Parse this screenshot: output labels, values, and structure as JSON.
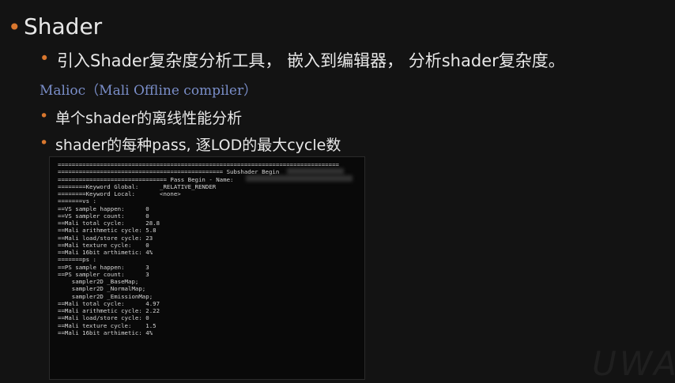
{
  "bullets": {
    "level0_glyph": "•",
    "level1_glyph": "•"
  },
  "slide": {
    "title": "Shader",
    "point1": "引入Shader复杂度分析工具， 嵌入到编辑器， 分析shader复杂度。",
    "tool_name": "Malioc（Mali Offline compiler）",
    "point2": "单个shader的离线性能分析",
    "point3": "shader的每种pass, 逐LOD的最大cycle数"
  },
  "code_lines": [
    "================================================================================",
    "=============================================== Subshader Begin",
    "=============================== Pass Begin - Name:",
    "========Keyword Global:      _RELATIVE_RENDER",
    "========Keyword Local:       <none>",
    "=======vs :",
    "==VS sample happen:      0",
    "==VS sampler count:      0",
    "==Mali total cycle:      28.8",
    "==Mali arithmetic cycle: 5.8",
    "==Mali load/store cycle: 23",
    "==Mali texture cycle:    0",
    "==Mali 16bit arthimetic: 4%",
    "=======ps :",
    "==PS sample happen:      3",
    "==PS sampler count:      3",
    "    sampler2D _BaseMap;",
    "    sampler2D _NormalMap;",
    "    sampler2D _EmissionMap;",
    "==Mali total cycle:      4.97",
    "==Mali arithmetic cycle: 2.22",
    "==Mali load/store cycle: 0",
    "==Mali texture cycle:    1.5",
    "==Mali 16bit arthimetic: 4%"
  ],
  "watermark": "UWA"
}
